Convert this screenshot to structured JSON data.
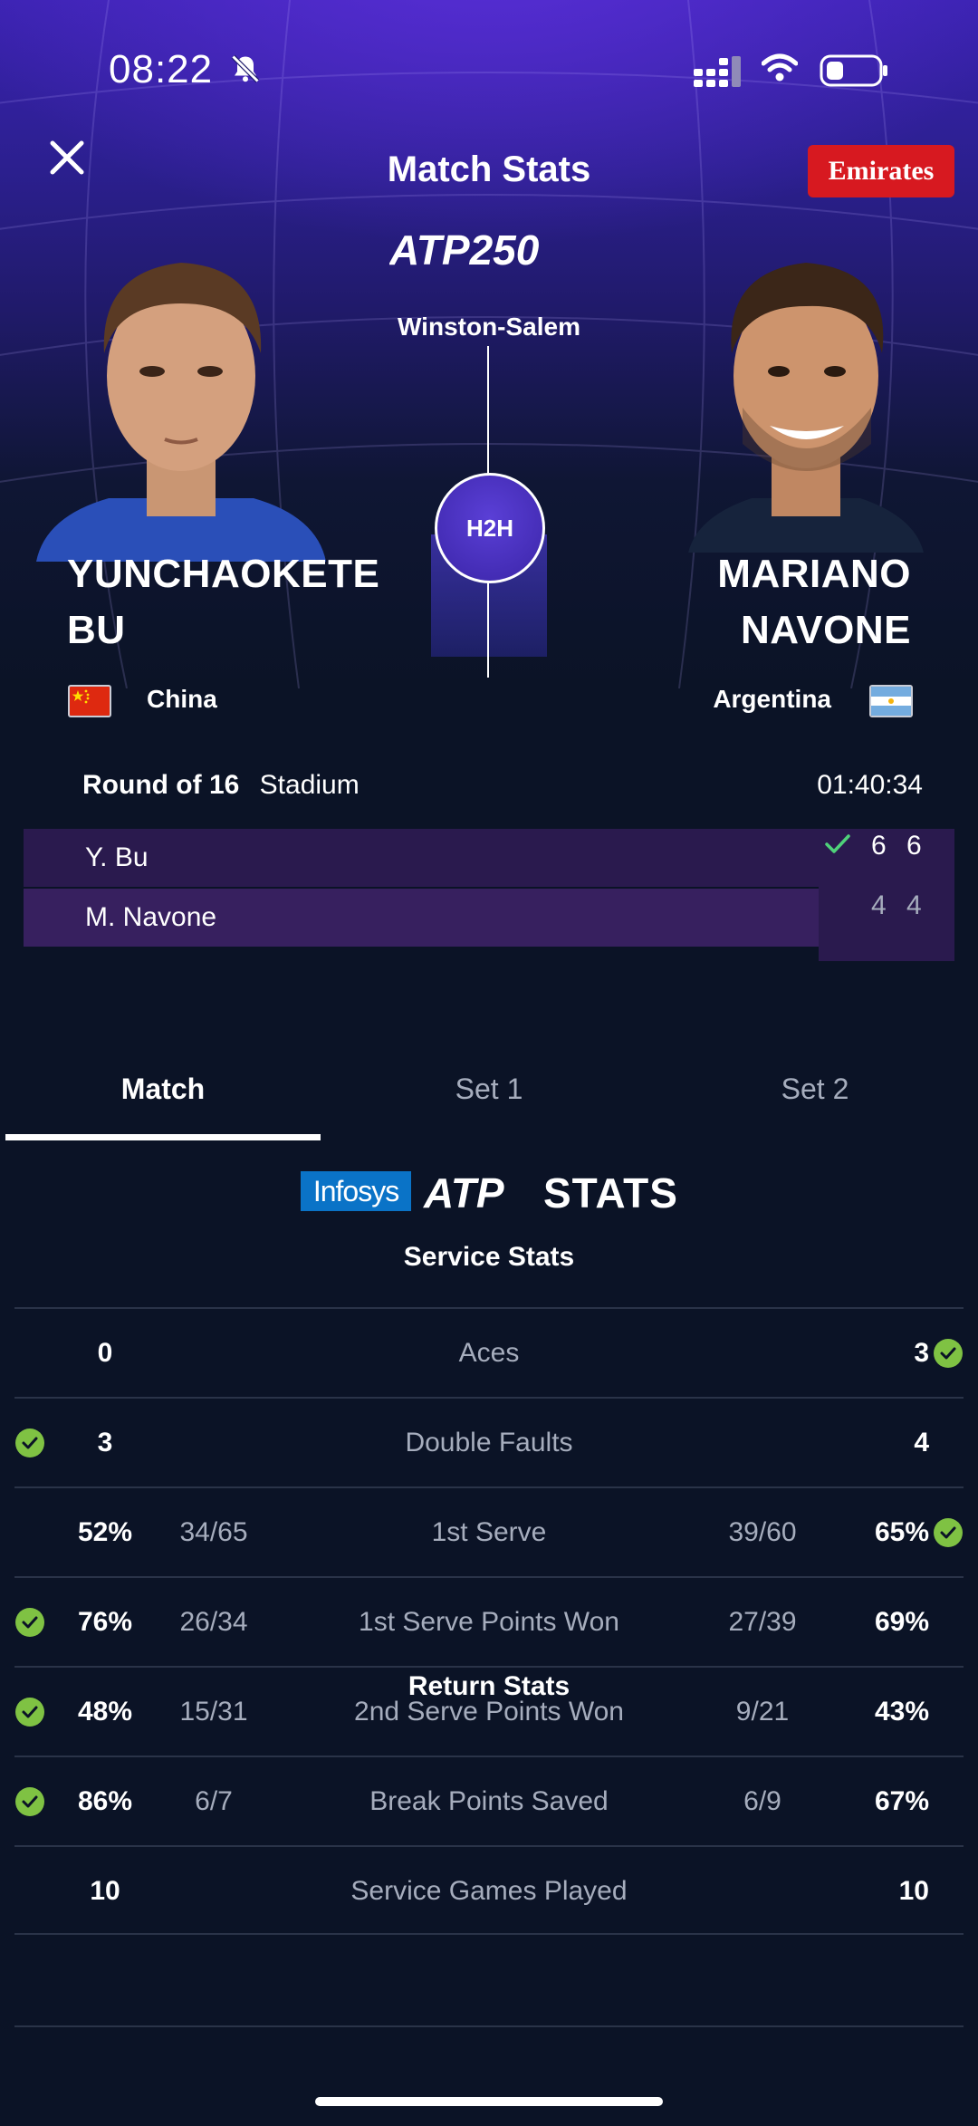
{
  "status_bar": {
    "time": "08:22"
  },
  "header": {
    "title": "Match Stats",
    "sponsor": "Emirates",
    "tournament_logo": "ATP250",
    "tournament": "Winston-Salem"
  },
  "h2h_label": "H2H",
  "players": {
    "left": {
      "name_line1": "YUNCHAOKETE",
      "name_line2": "BU",
      "country": "China",
      "short": "Y. Bu",
      "scores": [
        "6",
        "6"
      ]
    },
    "right": {
      "name_line1": "MARIANO",
      "name_line2": "NAVONE",
      "country": "Argentina",
      "short": "M. Navone",
      "scores": [
        "4",
        "4"
      ]
    }
  },
  "match_info": {
    "round": "Round of 16",
    "court": "Stadium",
    "duration": "01:40:34"
  },
  "tabs": [
    "Match",
    "Set 1",
    "Set 2"
  ],
  "stats_logo": {
    "infosys": "Infosys",
    "atp": "ATP",
    "stats": "STATS"
  },
  "service_title": "Service Stats",
  "service_stats": [
    {
      "label": "Aces",
      "left": "0",
      "left_frac": "",
      "right_frac": "",
      "right": "3",
      "winner": "right"
    },
    {
      "label": "Double Faults",
      "left": "3",
      "left_frac": "",
      "right_frac": "",
      "right": "4",
      "winner": "left"
    },
    {
      "label": "1st Serve",
      "left": "52%",
      "left_frac": "34/65",
      "right_frac": "39/60",
      "right": "65%",
      "winner": "right"
    },
    {
      "label": "1st Serve Points Won",
      "left": "76%",
      "left_frac": "26/34",
      "right_frac": "27/39",
      "right": "69%",
      "winner": "left"
    },
    {
      "label": "2nd Serve Points Won",
      "left": "48%",
      "left_frac": "15/31",
      "right_frac": "9/21",
      "right": "43%",
      "winner": "left"
    },
    {
      "label": "Break Points Saved",
      "left": "86%",
      "left_frac": "6/7",
      "right_frac": "6/9",
      "right": "67%",
      "winner": "left"
    },
    {
      "label": "Service Games Played",
      "left": "10",
      "left_frac": "",
      "right_frac": "",
      "right": "10",
      "winner": ""
    }
  ],
  "return_title": "Return Stats",
  "colors": {
    "background": "#0b1326",
    "score_row": "#2a1a4e",
    "winner_check": "#7fc243",
    "sponsor": "#d71920"
  }
}
